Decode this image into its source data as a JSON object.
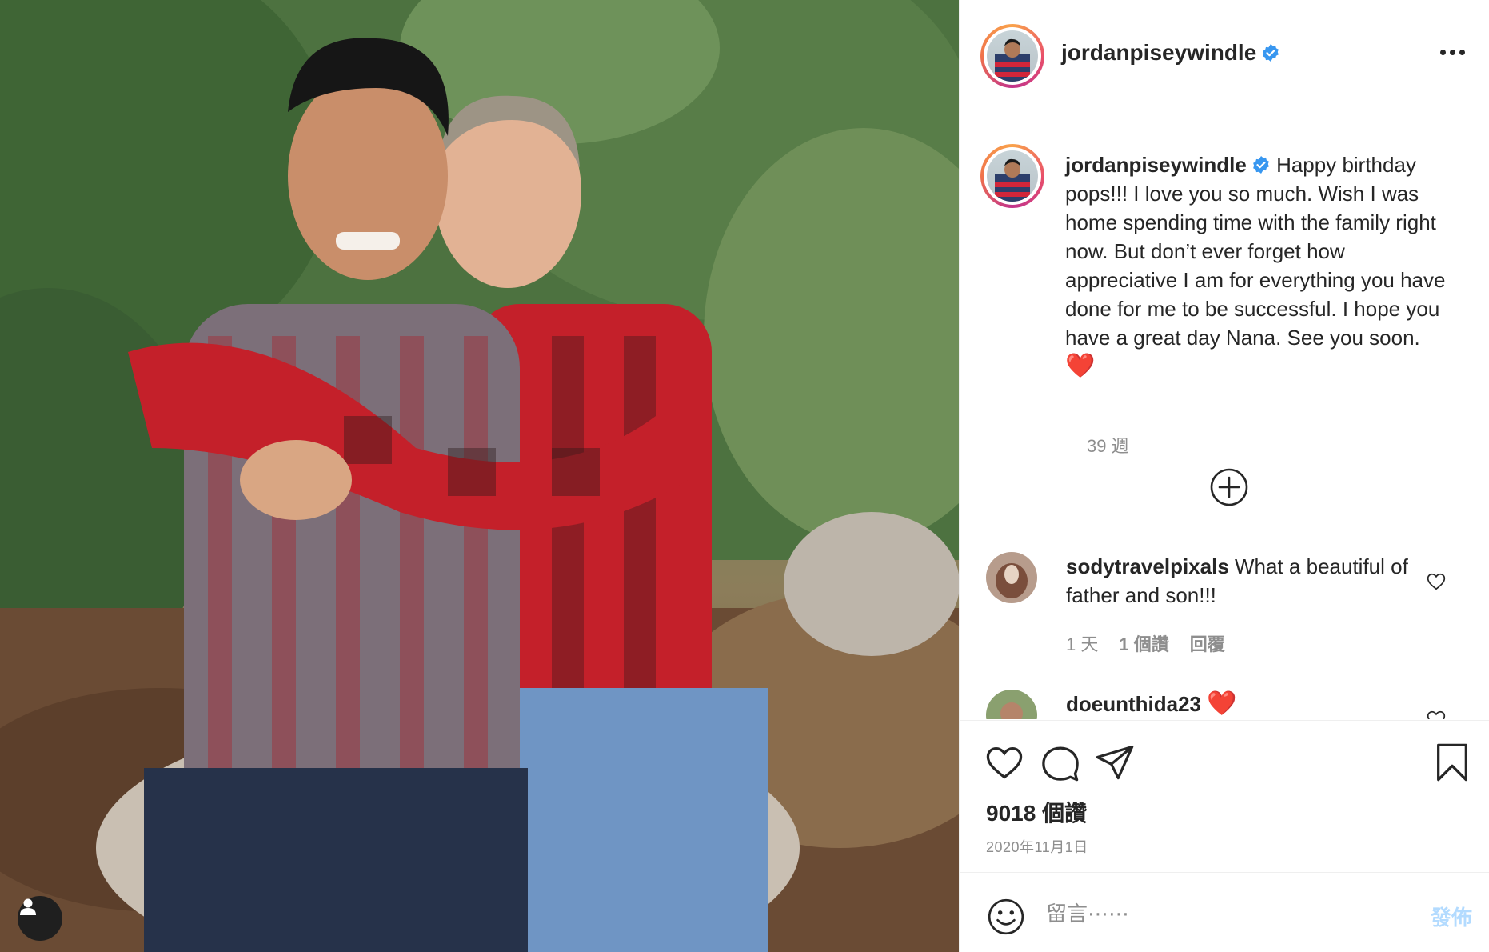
{
  "post": {
    "username": "jordanpiseywindle",
    "verified": true,
    "caption": "Happy birthday pops!!! I love you so much. Wish I was home spending time with the family right now. But don’t ever forget how appreciative I am for everything you have done for me to be successful. I hope you have a great day Nana. See you soon.",
    "caption_emoji": "❤️",
    "caption_time": "39 週",
    "likes": "9018 個讚",
    "date": "2020年11月1日"
  },
  "comments": [
    {
      "username": "sodytravelpixals",
      "text": "What a beautiful of father and son!!!",
      "time": "1 天",
      "likes": "1 個讚",
      "reply": "回覆"
    },
    {
      "username": "doeunthida23",
      "text": "❤️"
    }
  ],
  "comment_box": {
    "placeholder": "留言⋯⋯",
    "post_label": "發佈"
  },
  "icons": {
    "verified": "verified-badge-icon",
    "more": "more-options-icon",
    "load_more": "plus-circle-icon",
    "like": "heart-icon",
    "comment": "comment-bubble-icon",
    "share": "paper-plane-icon",
    "save": "bookmark-icon",
    "emoji": "smiley-icon",
    "tagged_user": "user-icon"
  },
  "colors": {
    "verified_blue": "#3897f0",
    "muted_text": "#8e8e8e",
    "post_button_disabled": "#b3dbff",
    "heart_red": "#e0202f"
  }
}
